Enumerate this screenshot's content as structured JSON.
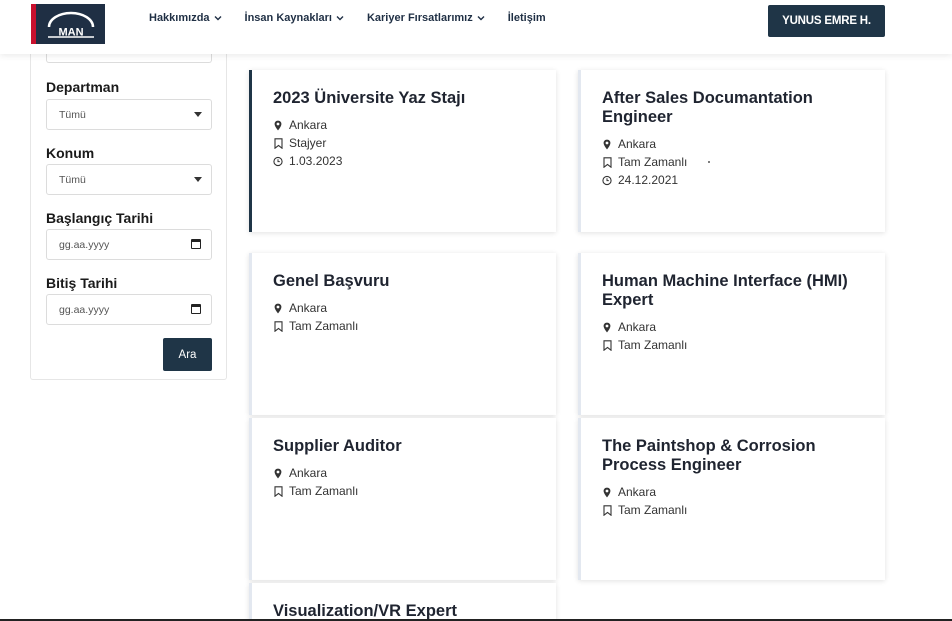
{
  "header": {
    "logo_text": "MAN",
    "nav": [
      {
        "label": "Hakkımızda",
        "has_dropdown": true
      },
      {
        "label": "İnsan Kaynakları",
        "has_dropdown": true
      },
      {
        "label": "Kariyer Fırsatlarımız",
        "has_dropdown": true
      },
      {
        "label": "İletişim",
        "has_dropdown": false
      }
    ],
    "user_button": "YUNUS EMRE H."
  },
  "filters": {
    "department": {
      "label": "Departman",
      "value": "Tümü"
    },
    "location": {
      "label": "Konum",
      "value": "Tümü"
    },
    "start_date": {
      "label": "Başlangıç Tarihi",
      "placeholder": "gg.aa.yyyy"
    },
    "end_date": {
      "label": "Bitiş Tarihi",
      "placeholder": "gg.aa.yyyy"
    },
    "search_button": "Ara"
  },
  "jobs": [
    {
      "title": "2023 Üniversite Yaz Stajı",
      "location": "Ankara",
      "type": "Stajyer",
      "date": "1.03.2023",
      "active": true
    },
    {
      "title": "After Sales Documantation Engineer",
      "location": "Ankara",
      "type": "Tam Zamanlı",
      "date": "24.12.2021",
      "active": false
    },
    {
      "title": "Genel Başvuru",
      "location": "Ankara",
      "type": "Tam Zamanlı",
      "active": false
    },
    {
      "title": "Human Machine Interface (HMI) Expert",
      "location": "Ankara",
      "type": "Tam Zamanlı",
      "active": false
    },
    {
      "title": "Supplier Auditor",
      "location": "Ankara",
      "type": "Tam Zamanlı",
      "active": false
    },
    {
      "title": "The Paintshop & Corrosion Process Engineer",
      "location": "Ankara",
      "type": "Tam Zamanlı",
      "active": false
    },
    {
      "title": "Visualization/VR Expert",
      "active": false
    }
  ],
  "icons": {
    "location": "map-marker-icon",
    "type": "bookmark-icon",
    "date": "clock-icon",
    "dropdown": "chevron-down-icon",
    "calendar": "calendar-icon"
  },
  "colors": {
    "primary": "#1f3547",
    "brand_red": "#c8102e",
    "card_accent": "#e3e8f0"
  }
}
